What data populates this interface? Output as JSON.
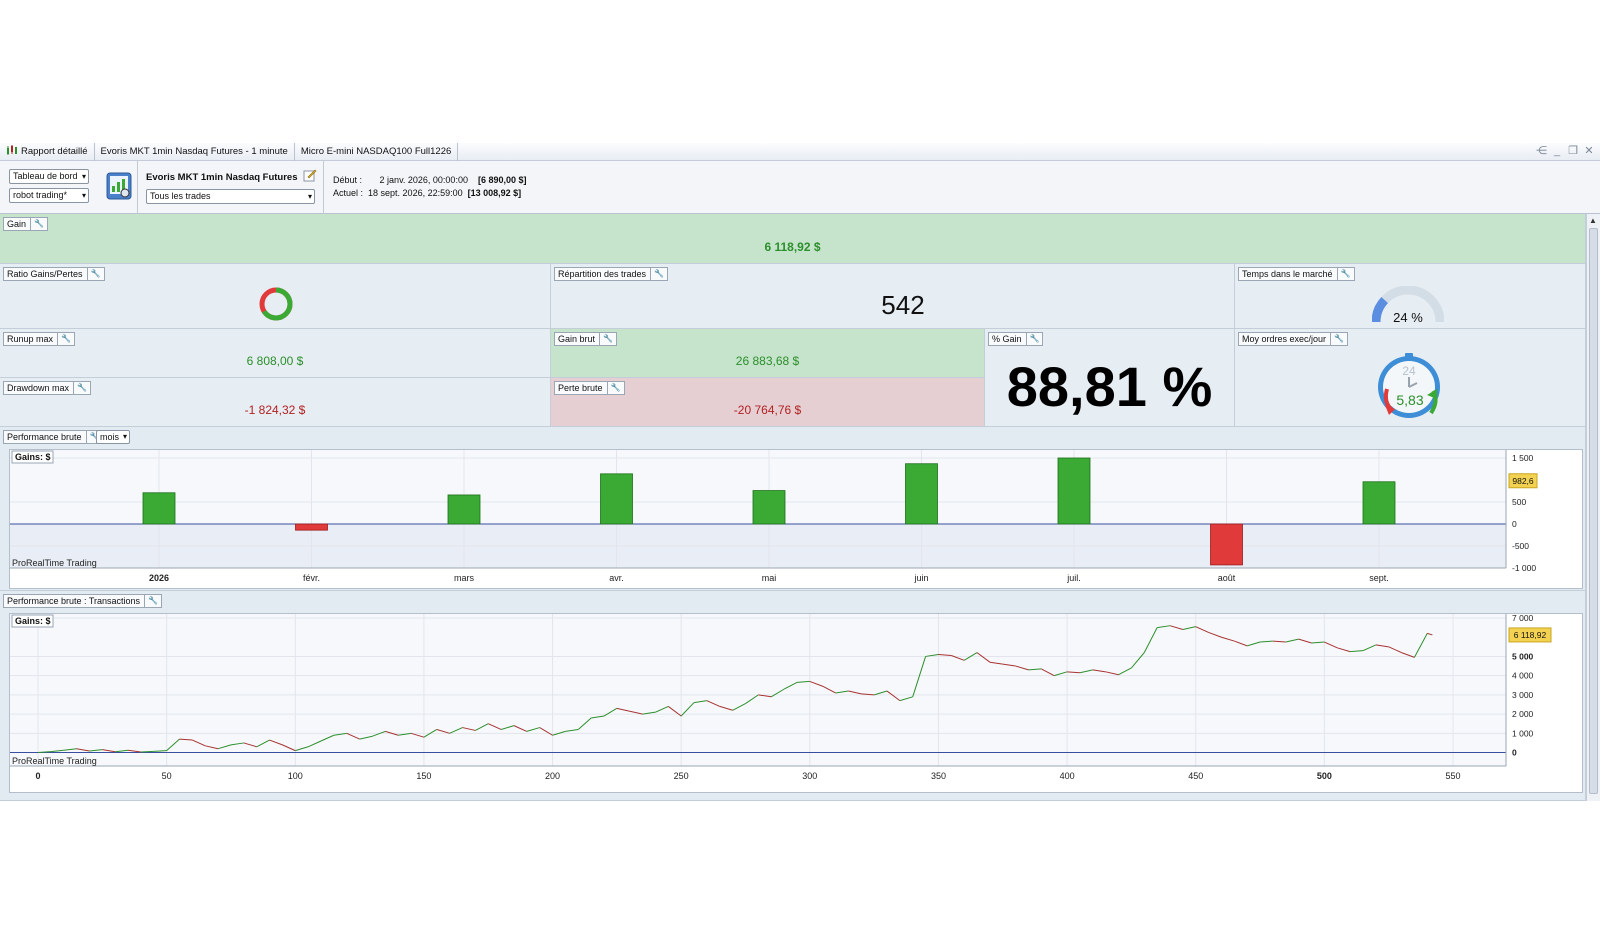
{
  "titlebar": {
    "segments": [
      "Rapport détaillé",
      "Evoris MKT 1min Nasdaq Futures - 1 minute",
      "Micro E-mini NASDAQ100 Full1226"
    ]
  },
  "toolbar": {
    "view_select": "Tableau de bord",
    "system_select": "robot trading*",
    "strategy_title": "Evoris MKT 1min Nasdaq Futures",
    "trades_select": "Tous les trades",
    "start_label": "Début :",
    "start_date": "2 janv. 2026, 00:00:00",
    "start_value": "[6 890,00 $]",
    "current_label": "Actuel :",
    "current_date": "18 sept. 2026, 22:59:00",
    "current_value": "[13 008,92 $]"
  },
  "panels": {
    "gain": {
      "label": "Gain",
      "value": "6 118,92 $"
    },
    "ratio": {
      "label": "Ratio Gains/Pertes",
      "win_fraction": 0.66
    },
    "repartition": {
      "label": "Répartition des trades",
      "value": "542"
    },
    "temps": {
      "label": "Temps dans le marché",
      "value": "24 %",
      "fraction": 0.24
    },
    "runup": {
      "label": "Runup max",
      "value": "6 808,00 $"
    },
    "gain_brut": {
      "label": "Gain brut",
      "value": "26 883,68 $"
    },
    "pct_gain": {
      "label": "% Gain",
      "value": "88,81 %"
    },
    "moy_ordres": {
      "label": "Moy ordres exec/jour",
      "value": "5,83",
      "clock_label": "24"
    },
    "drawdown": {
      "label": "Drawdown max",
      "value": "-1 824,32 $"
    },
    "perte_brute": {
      "label": "Perte brute",
      "value": "-20 764,76 $"
    },
    "perf_brute": {
      "label": "Performance brute",
      "period_select": "mois"
    },
    "perf_trans": {
      "label": "Performance brute : Transactions"
    }
  },
  "colors": {
    "positive": "#3aaa35",
    "negative": "#e03a3a",
    "green_panel": "#c6e4cc",
    "red_panel": "#e6cfd3",
    "line": "#2d8f2d",
    "baseline": "#3a4ea0"
  },
  "chart_data": [
    {
      "type": "bar",
      "title": "Gains: $",
      "watermark": "ProRealTime Trading",
      "categories": [
        "2026",
        "févr.",
        "mars",
        "avr.",
        "mai",
        "juin",
        "juil.",
        "août",
        "sept."
      ],
      "values": [
        710,
        -140,
        660,
        1140,
        760,
        1370,
        1500,
        -930,
        960
      ],
      "ylim": [
        -1000,
        1500
      ],
      "yticks": [
        1500,
        500,
        0,
        -500,
        -1000
      ],
      "ytick_labels": [
        "1 500",
        "500",
        "0",
        "-500",
        "-1 000"
      ],
      "last_value_label": "982,6",
      "last_value": 982.6
    },
    {
      "type": "line",
      "title": "Gains: $",
      "watermark": "ProRealTime Trading",
      "x": [
        0,
        5,
        10,
        15,
        20,
        25,
        30,
        35,
        40,
        45,
        50,
        55,
        60,
        65,
        70,
        75,
        80,
        85,
        90,
        95,
        100,
        105,
        110,
        115,
        120,
        125,
        130,
        135,
        140,
        145,
        150,
        155,
        160,
        165,
        170,
        175,
        180,
        185,
        190,
        195,
        200,
        205,
        210,
        215,
        220,
        225,
        230,
        235,
        240,
        245,
        250,
        255,
        260,
        265,
        270,
        275,
        280,
        285,
        290,
        295,
        300,
        305,
        310,
        315,
        320,
        325,
        330,
        335,
        340,
        345,
        350,
        355,
        360,
        365,
        370,
        375,
        380,
        385,
        390,
        395,
        400,
        405,
        410,
        415,
        420,
        425,
        430,
        435,
        440,
        445,
        450,
        455,
        460,
        465,
        470,
        475,
        480,
        485,
        490,
        495,
        500,
        505,
        510,
        515,
        520,
        525,
        530,
        535,
        540,
        542
      ],
      "y": [
        0,
        50,
        120,
        200,
        80,
        150,
        40,
        120,
        30,
        60,
        100,
        700,
        650,
        350,
        200,
        400,
        500,
        300,
        650,
        400,
        100,
        300,
        600,
        900,
        1000,
        700,
        850,
        1100,
        900,
        1000,
        800,
        1200,
        1000,
        1300,
        1150,
        1500,
        1200,
        1400,
        1100,
        1300,
        900,
        1100,
        1200,
        1800,
        1900,
        2300,
        2150,
        2000,
        2100,
        2400,
        1900,
        2600,
        2700,
        2400,
        2200,
        2550,
        3000,
        2900,
        3300,
        3650,
        3700,
        3450,
        3100,
        3200,
        3050,
        3000,
        3200,
        2700,
        2900,
        5000,
        5100,
        5050,
        4800,
        5200,
        4700,
        4600,
        4500,
        4300,
        4350,
        4000,
        4200,
        4150,
        4300,
        4200,
        4050,
        4400,
        5200,
        6500,
        6600,
        6400,
        6550,
        6250,
        6000,
        5800,
        5550,
        5750,
        5800,
        5750,
        5900,
        5700,
        5750,
        5450,
        5250,
        5300,
        5600,
        5500,
        5200,
        4950,
        6200,
        6118.92
      ],
      "xlim": [
        0,
        580
      ],
      "xticks": [
        0,
        50,
        100,
        150,
        200,
        250,
        300,
        350,
        400,
        450,
        500,
        550
      ],
      "ylim": [
        -700,
        7000
      ],
      "yticks": [
        7000,
        5000,
        4000,
        3000,
        2000,
        1000,
        0
      ],
      "ytick_labels": [
        "7 000",
        "5 000",
        "4 000",
        "3 000",
        "2 000",
        "1 000",
        "0"
      ],
      "last_value_label": "6 118,92",
      "last_value": 6118.92
    }
  ]
}
